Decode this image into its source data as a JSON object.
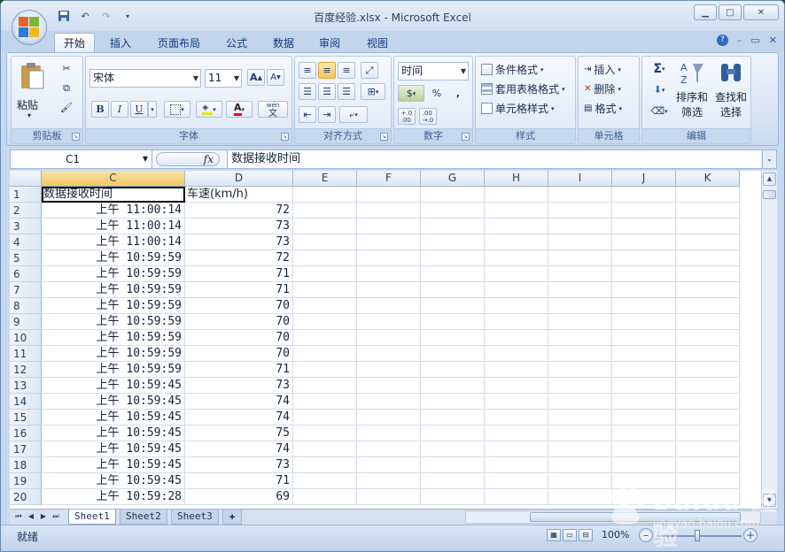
{
  "window": {
    "title": "百度经验.xlsx - Microsoft Excel",
    "controls": [
      "–",
      "□",
      "✕"
    ]
  },
  "qat": {
    "undo_icon": "undo-icon",
    "redo_icon": "redo-icon",
    "save_icon": "save-icon"
  },
  "tabs": [
    "开始",
    "插入",
    "页面布局",
    "公式",
    "数据",
    "审阅",
    "视图"
  ],
  "active_tab": "开始",
  "ribbon": {
    "clipboard": {
      "paste": "粘贴",
      "label": "剪贴板"
    },
    "font": {
      "name": "宋体",
      "size": "11",
      "bold": "B",
      "italic": "I",
      "underline": "U",
      "grow": "A",
      "shrink": "A",
      "font_color": "A",
      "phonetic": "wén",
      "phonetic_char": "文",
      "label": "字体"
    },
    "alignment": {
      "label": "对齐方式"
    },
    "number": {
      "format": "时间",
      "percent": "%",
      "comma": ",",
      "inc": "+.0\n.00",
      "dec": ".00\n→.0",
      "label": "数字"
    },
    "styles": {
      "cond": "条件格式",
      "table": "套用表格格式",
      "cell": "单元格样式",
      "label": "样式"
    },
    "cells": {
      "insert": "插入",
      "delete": "删除",
      "format": "格式",
      "label": "单元格"
    },
    "editing": {
      "sum": "Σ",
      "sort": "排序和",
      "sort2": "筛选",
      "find": "查找和",
      "find2": "选择",
      "label": "编辑"
    }
  },
  "formula_bar": {
    "name_box": "C1",
    "fx": "fx",
    "value": "数据接收时间"
  },
  "grid": {
    "columns": [
      "C",
      "D",
      "E",
      "F",
      "G",
      "H",
      "I",
      "J",
      "K"
    ],
    "header_row": {
      "c": "数据接收时间",
      "d": "车速(km/h)"
    },
    "rows": [
      {
        "n": "1"
      },
      {
        "n": "2",
        "time": "上午 11:00:14",
        "speed": "72"
      },
      {
        "n": "3",
        "time": "上午 11:00:14",
        "speed": "73"
      },
      {
        "n": "4",
        "time": "上午 11:00:14",
        "speed": "73"
      },
      {
        "n": "5",
        "time": "上午 10:59:59",
        "speed": "72"
      },
      {
        "n": "6",
        "time": "上午 10:59:59",
        "speed": "71"
      },
      {
        "n": "7",
        "time": "上午 10:59:59",
        "speed": "71"
      },
      {
        "n": "8",
        "time": "上午 10:59:59",
        "speed": "70"
      },
      {
        "n": "9",
        "time": "上午 10:59:59",
        "speed": "70"
      },
      {
        "n": "10",
        "time": "上午 10:59:59",
        "speed": "70"
      },
      {
        "n": "11",
        "time": "上午 10:59:59",
        "speed": "70"
      },
      {
        "n": "12",
        "time": "上午 10:59:59",
        "speed": "71"
      },
      {
        "n": "13",
        "time": "上午 10:59:45",
        "speed": "73"
      },
      {
        "n": "14",
        "time": "上午 10:59:45",
        "speed": "74"
      },
      {
        "n": "15",
        "time": "上午 10:59:45",
        "speed": "74"
      },
      {
        "n": "16",
        "time": "上午 10:59:45",
        "speed": "75"
      },
      {
        "n": "17",
        "time": "上午 10:59:45",
        "speed": "74"
      },
      {
        "n": "18",
        "time": "上午 10:59:45",
        "speed": "73"
      },
      {
        "n": "19",
        "time": "上午 10:59:45",
        "speed": "71"
      },
      {
        "n": "20",
        "time": "上午 10:59:28",
        "speed": "69"
      }
    ]
  },
  "sheets": [
    "Sheet1",
    "Sheet2",
    "Sheet3"
  ],
  "active_sheet": "Sheet1",
  "status": {
    "text": "就绪",
    "zoom": "100%"
  },
  "watermark": {
    "text": "Baidu 经验",
    "url": "jingyan.baidu.com"
  },
  "colors": {
    "accent": "#f3c665",
    "frame": "#c7d9ee"
  }
}
